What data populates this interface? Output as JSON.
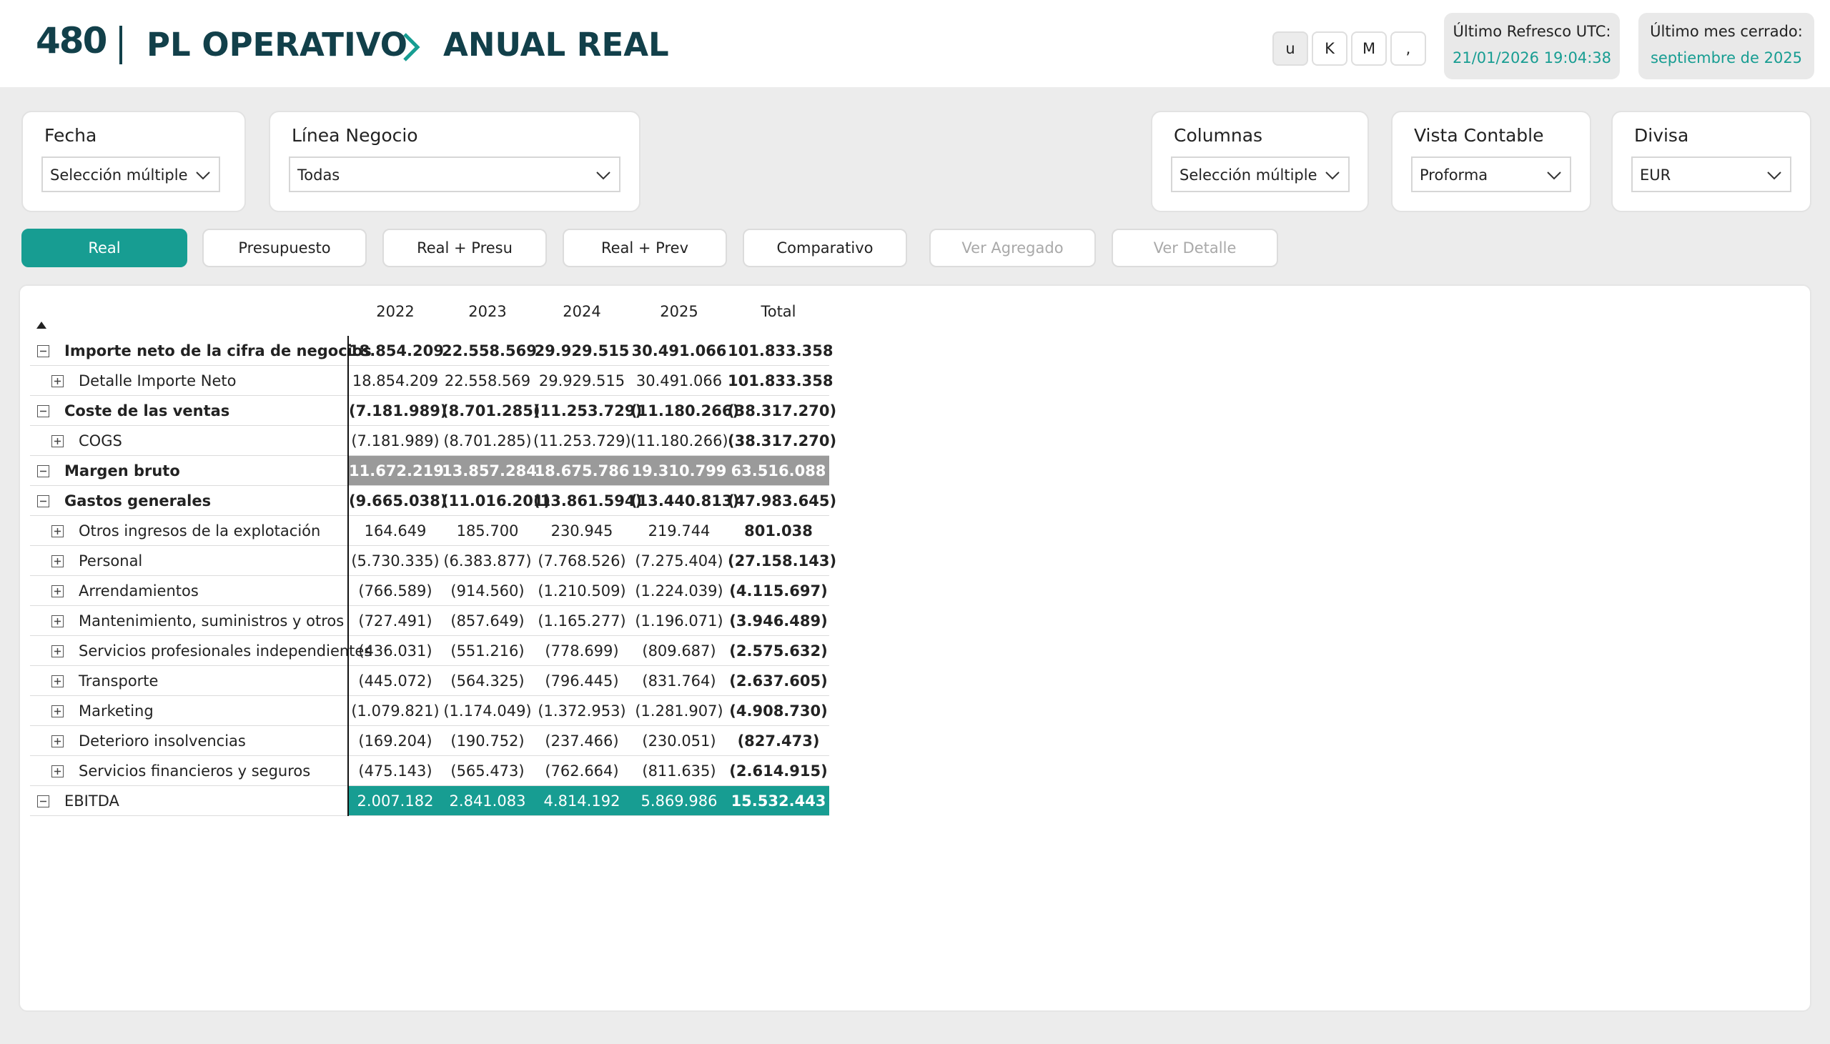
{
  "header": {
    "logo": "480",
    "title": "PL OPERATIVO",
    "subtitle": "ANUAL REAL",
    "unit_buttons": [
      "u",
      "K",
      "M",
      ","
    ],
    "refresh": {
      "label": "Último Refresco UTC:",
      "value": "21/01/2026 19:04:38"
    },
    "closed": {
      "label": "Último mes cerrado:",
      "value": "septiembre de 2025"
    }
  },
  "filters": {
    "fecha": {
      "label": "Fecha",
      "value": "Selección múltiple"
    },
    "linea": {
      "label": "Línea Negocio",
      "value": "Todas"
    },
    "columnas": {
      "label": "Columnas",
      "value": "Selección múltiple"
    },
    "vista": {
      "label": "Vista Contable",
      "value": "Proforma"
    },
    "divisa": {
      "label": "Divisa",
      "value": "EUR"
    }
  },
  "views": {
    "real": "Real",
    "presupuesto": "Presupuesto",
    "real_presu": "Real + Presu",
    "real_prev": "Real + Prev",
    "comparativo": "Comparativo",
    "ver_agregado": "Ver Agregado",
    "ver_detalle": "Ver Detalle"
  },
  "colors": {
    "accent": "#179d92",
    "dark": "#12404a",
    "highlight_grey": "#9a9a9a"
  },
  "table": {
    "columns": [
      "2022",
      "2023",
      "2024",
      "2025",
      "Total"
    ],
    "rows": [
      {
        "label": "Importe neto de la cifra de negocios",
        "level": 0,
        "bold": true,
        "values": [
          "18.854.209",
          "22.558.569",
          "29.929.515",
          "30.491.066",
          "101.833.358"
        ]
      },
      {
        "label": "Detalle Importe Neto",
        "level": 1,
        "values": [
          "18.854.209",
          "22.558.569",
          "29.929.515",
          "30.491.066",
          "101.833.358"
        ]
      },
      {
        "label": "Coste de las ventas",
        "level": 0,
        "bold": true,
        "values": [
          "(7.181.989)",
          "(8.701.285)",
          "(11.253.729)",
          "(11.180.266)",
          "(38.317.270)"
        ]
      },
      {
        "label": "COGS",
        "level": 1,
        "values": [
          "(7.181.989)",
          "(8.701.285)",
          "(11.253.729)",
          "(11.180.266)",
          "(38.317.270)"
        ]
      },
      {
        "label": "Margen bruto",
        "level": 0,
        "bold": true,
        "highlight": "grey",
        "values": [
          "11.672.219",
          "13.857.284",
          "18.675.786",
          "19.310.799",
          "63.516.088"
        ]
      },
      {
        "label": "Gastos generales",
        "level": 0,
        "bold": true,
        "values": [
          "(9.665.038)",
          "(11.016.201)",
          "(13.861.594)",
          "(13.440.813)",
          "(47.983.645)"
        ]
      },
      {
        "label": "Otros ingresos de la explotación",
        "level": 1,
        "values": [
          "164.649",
          "185.700",
          "230.945",
          "219.744",
          "801.038"
        ]
      },
      {
        "label": "Personal",
        "level": 1,
        "values": [
          "(5.730.335)",
          "(6.383.877)",
          "(7.768.526)",
          "(7.275.404)",
          "(27.158.143)"
        ]
      },
      {
        "label": "Arrendamientos",
        "level": 1,
        "values": [
          "(766.589)",
          "(914.560)",
          "(1.210.509)",
          "(1.224.039)",
          "(4.115.697)"
        ]
      },
      {
        "label": "Mantenimiento, suministros y otros",
        "level": 1,
        "values": [
          "(727.491)",
          "(857.649)",
          "(1.165.277)",
          "(1.196.071)",
          "(3.946.489)"
        ]
      },
      {
        "label": "Servicios profesionales independientes",
        "level": 1,
        "values": [
          "(436.031)",
          "(551.216)",
          "(778.699)",
          "(809.687)",
          "(2.575.632)"
        ]
      },
      {
        "label": "Transporte",
        "level": 1,
        "values": [
          "(445.072)",
          "(564.325)",
          "(796.445)",
          "(831.764)",
          "(2.637.605)"
        ]
      },
      {
        "label": "Marketing",
        "level": 1,
        "values": [
          "(1.079.821)",
          "(1.174.049)",
          "(1.372.953)",
          "(1.281.907)",
          "(4.908.730)"
        ]
      },
      {
        "label": "Deterioro insolvencias",
        "level": 1,
        "values": [
          "(169.204)",
          "(190.752)",
          "(237.466)",
          "(230.051)",
          "(827.473)"
        ]
      },
      {
        "label": "Servicios financieros y seguros",
        "level": 1,
        "values": [
          "(475.143)",
          "(565.473)",
          "(762.664)",
          "(811.635)",
          "(2.614.915)"
        ]
      },
      {
        "label": "EBITDA",
        "level": 0,
        "highlight": "teal",
        "values": [
          "2.007.182",
          "2.841.083",
          "4.814.192",
          "5.869.986",
          "15.532.443"
        ]
      }
    ]
  }
}
